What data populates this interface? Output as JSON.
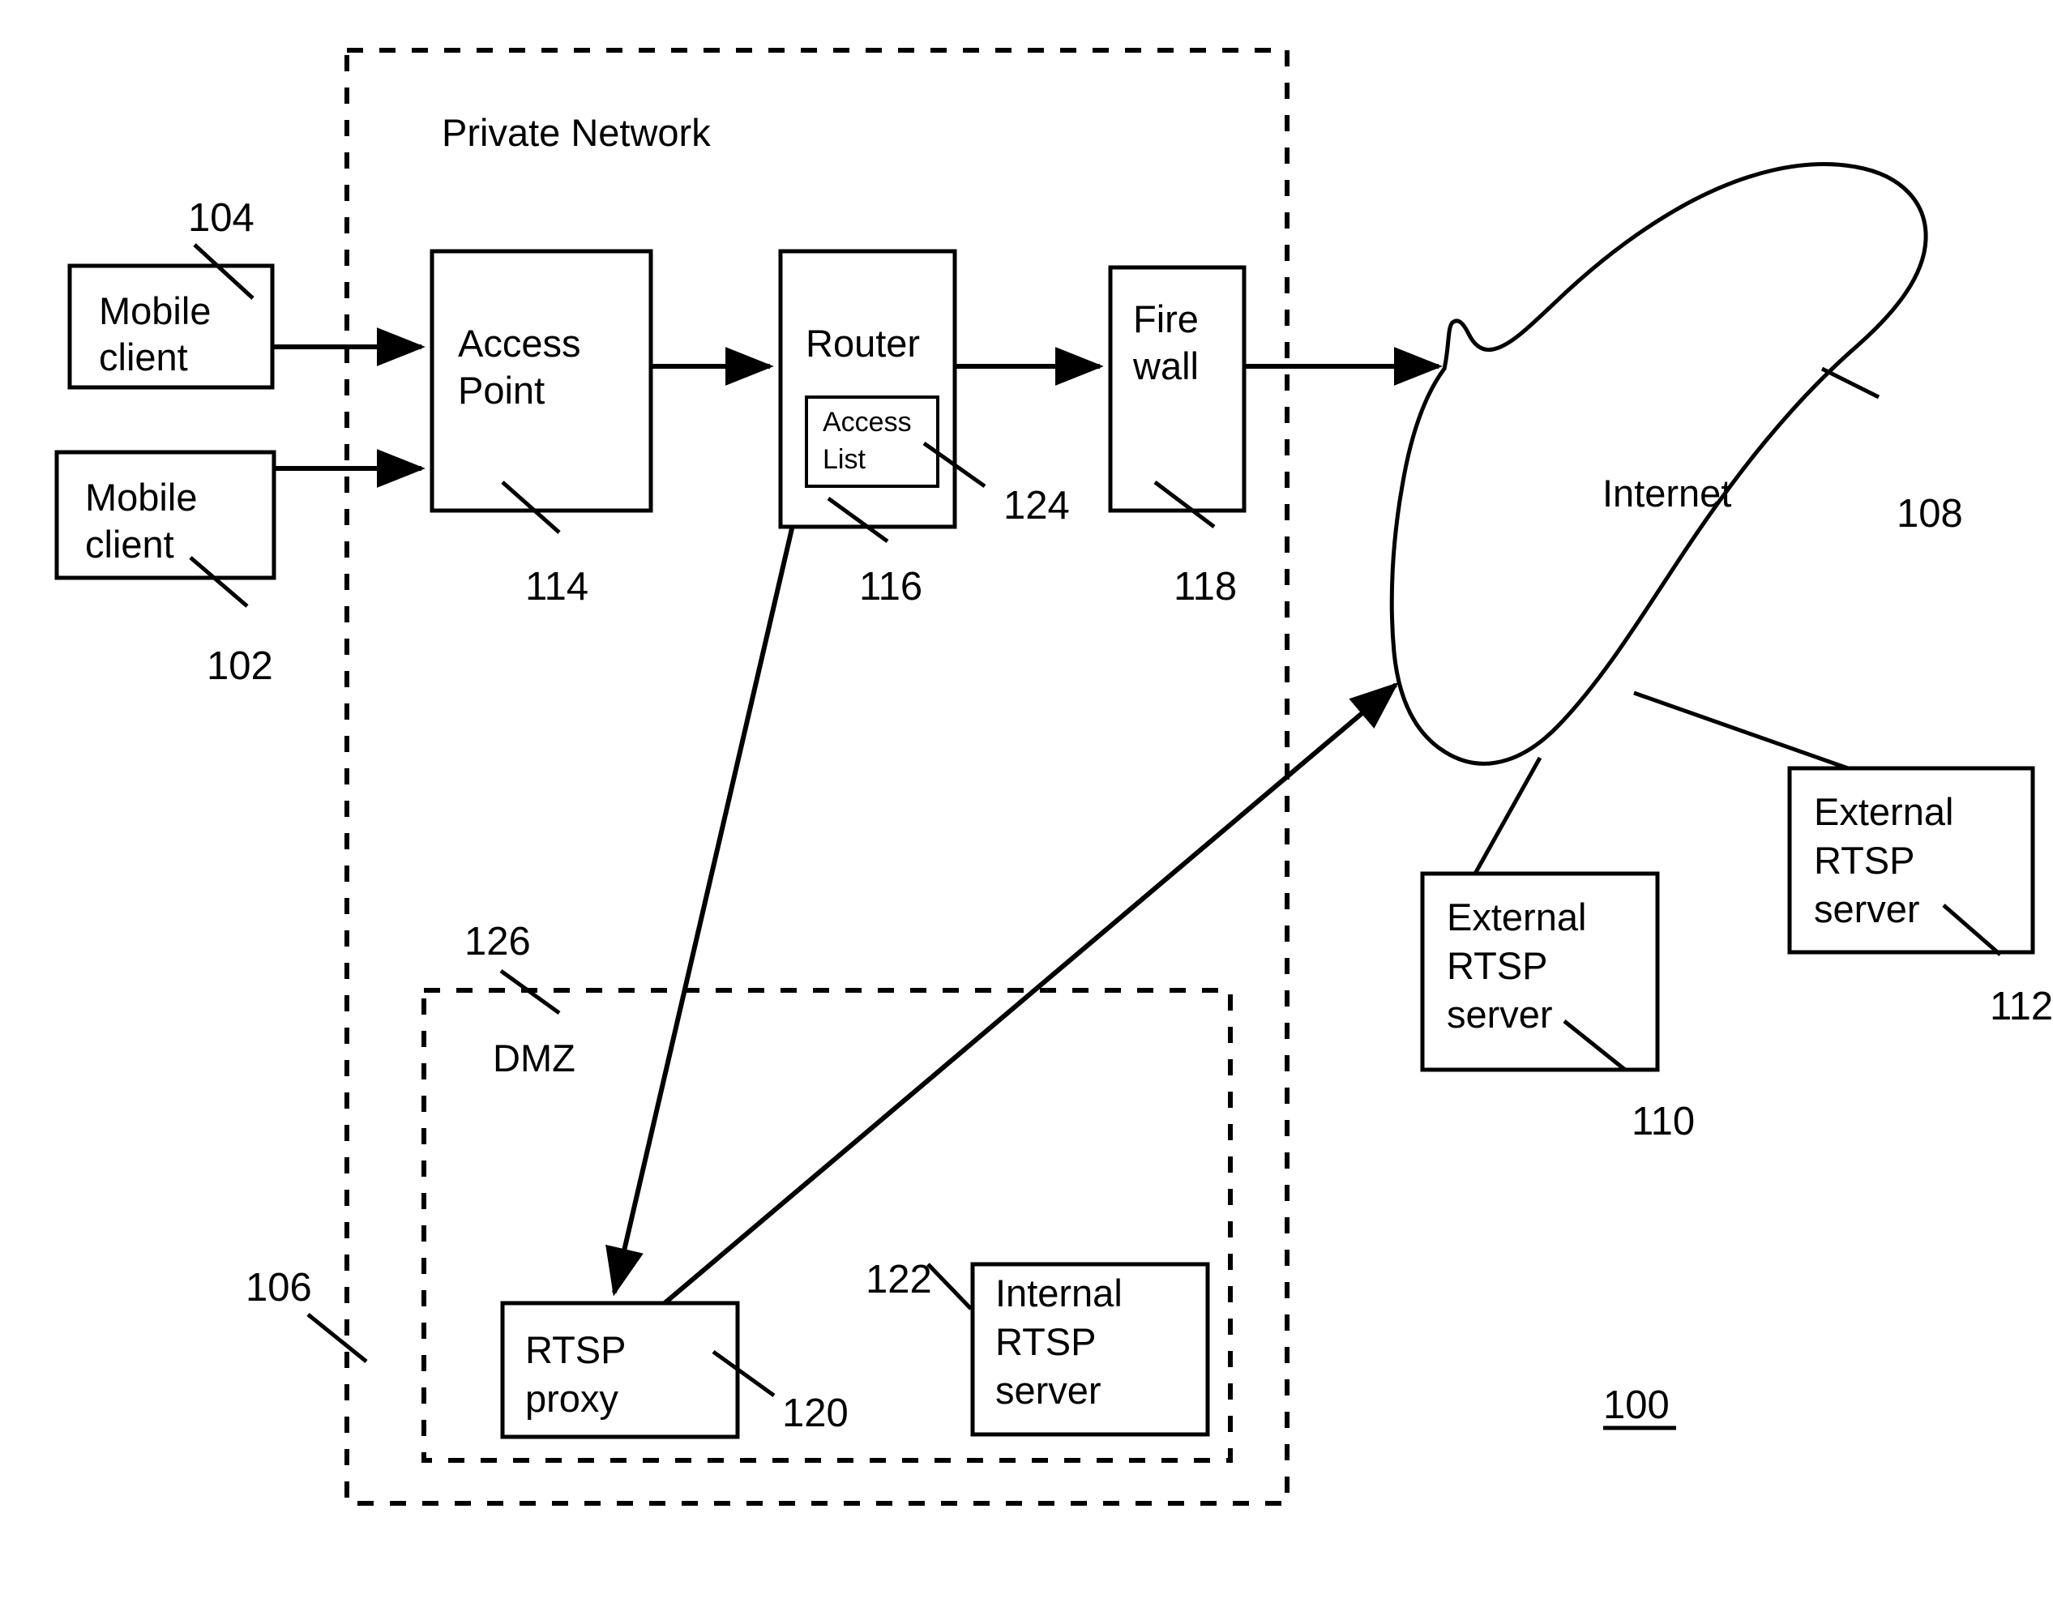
{
  "figure": {
    "figure_number": "100",
    "title": ""
  },
  "zones": [
    {
      "id": "private-network",
      "label": "Private Network",
      "ref": "106"
    },
    {
      "id": "dmz",
      "label": "DMZ",
      "ref": "126"
    }
  ],
  "nodes": [
    {
      "id": "mobile-client-1",
      "lines": [
        "Mobile",
        "client"
      ],
      "ref": "104"
    },
    {
      "id": "mobile-client-2",
      "lines": [
        "Mobile",
        "client"
      ],
      "ref": "102"
    },
    {
      "id": "access-point",
      "lines": [
        "Access",
        "Point"
      ],
      "ref": "114"
    },
    {
      "id": "router",
      "lines": [
        "Router"
      ],
      "ref": "116"
    },
    {
      "id": "access-list",
      "lines": [
        "Access",
        "List"
      ],
      "ref": "124"
    },
    {
      "id": "firewall",
      "lines": [
        "Fire",
        "wall"
      ],
      "ref": "118"
    },
    {
      "id": "internet",
      "lines": [
        "Internet"
      ],
      "ref": "108"
    },
    {
      "id": "external-rtsp-server-1",
      "lines": [
        "External",
        "RTSP",
        "server"
      ],
      "ref": "110"
    },
    {
      "id": "external-rtsp-server-2",
      "lines": [
        "External",
        "RTSP",
        "server"
      ],
      "ref": "112"
    },
    {
      "id": "rtsp-proxy",
      "lines": [
        "RTSP",
        "proxy"
      ],
      "ref": "120"
    },
    {
      "id": "internal-rtsp-server",
      "lines": [
        "Internal",
        "RTSP",
        "server"
      ],
      "ref": "122"
    }
  ],
  "text": {
    "private_network": "Private Network",
    "dmz": "DMZ",
    "mobile": "Mobile",
    "client": "client",
    "access": "Access",
    "point": "Point",
    "router": "Router",
    "access_small": "Access",
    "list_small": "List",
    "fire": "Fire",
    "wall": "wall",
    "internet": "Internet",
    "external": "External",
    "rtsp": "RTSP",
    "server": "server",
    "rtsp_proxy_line1": "RTSP",
    "rtsp_proxy_line2": "proxy",
    "internal": "Internal",
    "internal_rtsp": "RTSP",
    "internal_server": "server"
  },
  "refs": {
    "r100": "100",
    "r102": "102",
    "r104": "104",
    "r106": "106",
    "r108": "108",
    "r110": "110",
    "r112": "112",
    "r114": "114",
    "r116": "116",
    "r118": "118",
    "r120": "120",
    "r122": "122",
    "r124": "124",
    "r126": "126"
  },
  "colors": {
    "stroke": "#000000",
    "background": "#ffffff"
  }
}
